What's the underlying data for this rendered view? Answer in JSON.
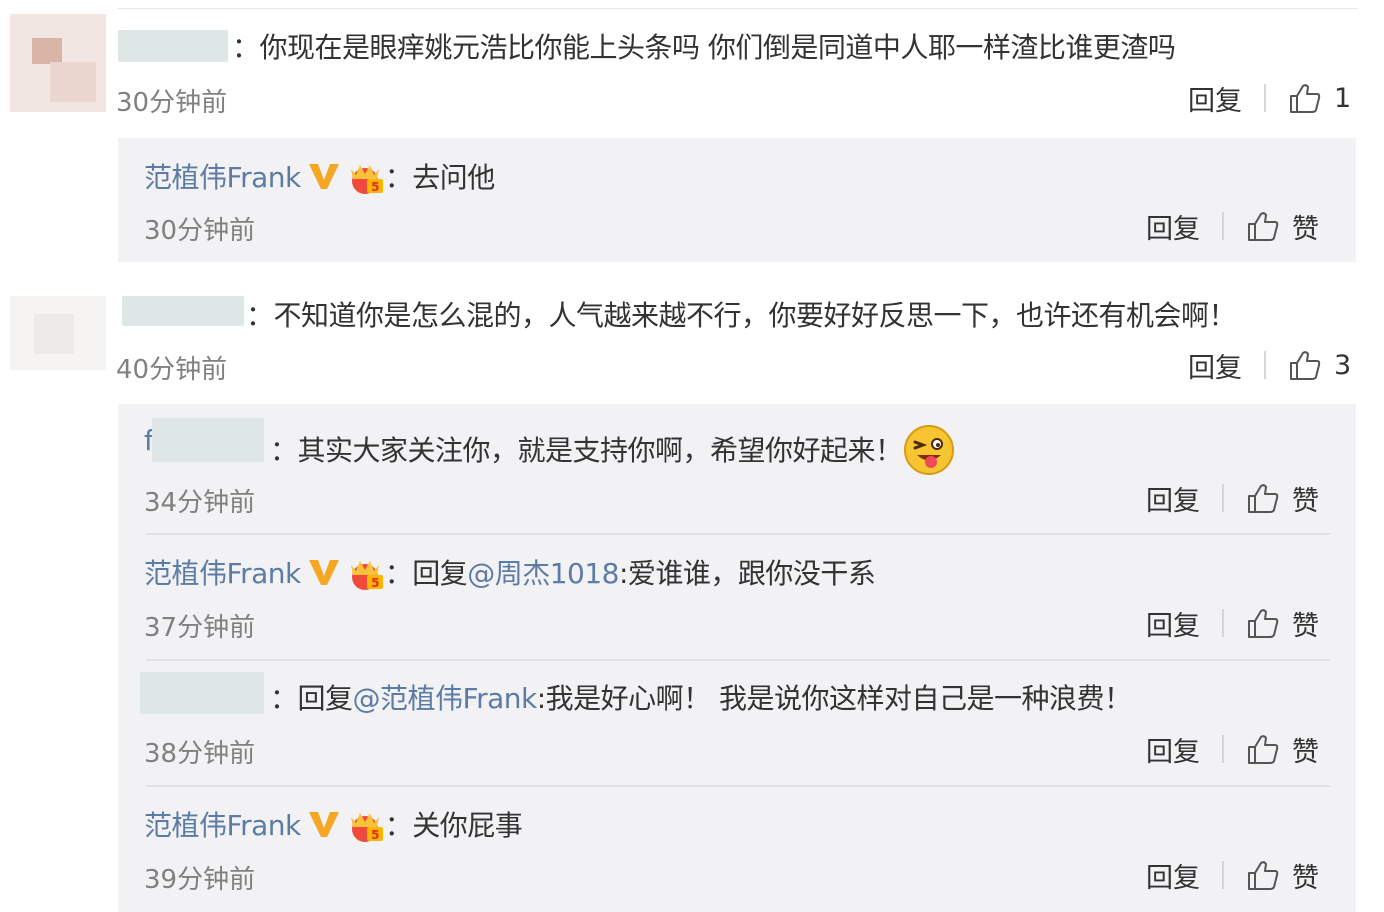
{
  "comments": [
    {
      "text": "：你现在是眼痒姚元浩比你能上头条吗 你们倒是同道中人耶一样渣比谁更渣吗",
      "time": "30分钟前",
      "reply_label": "回复",
      "like_count": "1"
    },
    {
      "text": "：不知道你是怎么混的，人气越来越不行，你要好好反思一下，也许还有机会啊！",
      "time": "40分钟前",
      "reply_label": "回复",
      "like_count": "3"
    }
  ],
  "replies_a": [
    {
      "author": "范植伟Frank",
      "text": "：去问他",
      "time": "30分钟前",
      "reply_label": "回复",
      "like_label": "赞"
    }
  ],
  "replies_b": [
    {
      "author_partial": "f",
      "text": "：其实大家关注你，就是支持你啊，希望你好起来！",
      "time": "34分钟前",
      "reply_label": "回复",
      "like_label": "赞"
    },
    {
      "author": "范植伟Frank",
      "text_prefix": "：回复",
      "mention": "@周杰1018",
      "text": ":爱谁谁，跟你没干系",
      "time": "37分钟前",
      "reply_label": "回复",
      "like_label": "赞"
    },
    {
      "text_prefix": "：回复",
      "mention": "@范植伟Frank",
      "text": ":我是好心啊！ 我是说你这样对自己是一种浪费！",
      "time": "38分钟前",
      "reply_label": "回复",
      "like_label": "赞"
    },
    {
      "author": "范植伟Frank",
      "text": "：关你屁事",
      "time": "39分钟前",
      "reply_label": "回复",
      "like_label": "赞"
    }
  ],
  "icons": {
    "like": "thumbs-up-icon",
    "verified": "verified-v-icon",
    "member": "member-crown-icon",
    "emoji": "tongue-wink-emoji-icon"
  },
  "colors": {
    "username": "#5c7ca3",
    "time": "#808080",
    "reply_bg": "#f2f2f5",
    "verified": "#f5a623"
  }
}
